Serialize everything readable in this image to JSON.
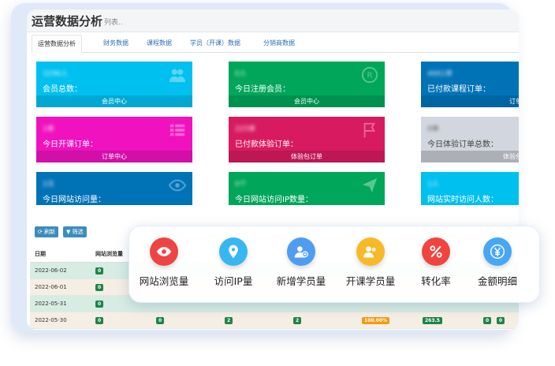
{
  "header": {
    "title": "运营数据分析",
    "subtitle": "列表.."
  },
  "tabs": [
    "运营数据分析",
    "财务数据",
    "课程数据",
    "学员（开课）数据",
    "分销商数据"
  ],
  "cards": [
    {
      "num": "3296人",
      "label": "会员总数：",
      "footer": "会员中心",
      "color": "#00c0ef",
      "icon": "users-icon"
    },
    {
      "num": "0人",
      "label": "今日注册会员：",
      "footer": "会员中心",
      "color": "#00a65a",
      "icon": "registered-icon"
    },
    {
      "num": "4661单",
      "label": "已付款课程订单：",
      "footer": "订单中心",
      "color": "#0073b7",
      "icon": "cart-icon"
    },
    {
      "num": "1单",
      "label": "今日开课订单：",
      "footer": "订单中心",
      "color": "#f012be",
      "icon": "list-icon"
    },
    {
      "num": "225单",
      "label": "已付款体验订单：",
      "footer": "体验包订单",
      "color": "#d81b60",
      "icon": "flag-icon"
    },
    {
      "num": "0单",
      "label": "今日体验订单总数：",
      "footer": "体验包订单",
      "color": "#d2d6de",
      "icon": "bag-icon"
    },
    {
      "num": "2次",
      "label": "今日网站访问量：",
      "footer": "",
      "color": "#0073b7",
      "icon": "eye-icon"
    },
    {
      "num": "0个",
      "label": "今日网站访问IP数量：",
      "footer": "",
      "color": "#00a65a",
      "icon": "send-icon"
    },
    {
      "num": "1人",
      "label": "网站实时访问人数：",
      "footer": "",
      "color": "#00c0ef",
      "icon": "user-icon"
    }
  ],
  "toolbar": {
    "refresh": "刷新",
    "filter": "筛选"
  },
  "table": {
    "headers": [
      "日期",
      "网站浏览量"
    ],
    "rows": [
      {
        "date": "2022-06-02",
        "v1": "0"
      },
      {
        "date": "2022-06-01",
        "v1": "0"
      },
      {
        "date": "2022-05-31",
        "v1": "0"
      },
      {
        "date": "2022-05-30",
        "v1": "0",
        "v2": "0",
        "v3": "2",
        "v4": "2",
        "rate": "100.00%",
        "amount": "263.5",
        "v7": "0",
        "v8": "0"
      }
    ]
  },
  "features": [
    {
      "label": "网站浏览量",
      "icon": "eye-icon",
      "color": "#ef4444"
    },
    {
      "label": "访问IP量",
      "icon": "location-pin-icon",
      "color": "#38b6f1"
    },
    {
      "label": "新增学员量",
      "icon": "add-user-icon",
      "color": "#4f9df0"
    },
    {
      "label": "开课学员量",
      "icon": "group-icon",
      "color": "#f7b928"
    },
    {
      "label": "转化率",
      "icon": "percent-icon",
      "color": "#f0443f"
    },
    {
      "label": "金额明细",
      "icon": "yen-icon",
      "color": "#46a7f5"
    }
  ]
}
